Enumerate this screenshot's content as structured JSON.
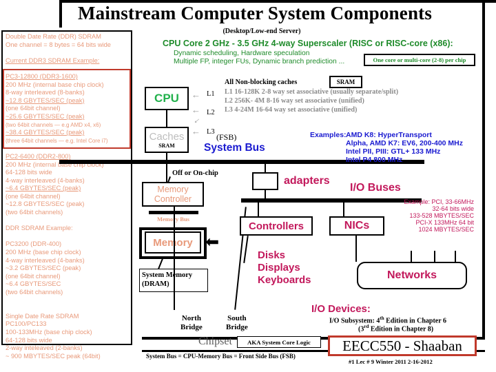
{
  "title": "Mainstream Computer System Components",
  "subtitle": "(Desktop/Low-end Server)",
  "ddr_panel": {
    "header": [
      "Double Date Rate (DDR) SDRAM",
      "One channel = 8 bytes = 64 bits wide"
    ],
    "ddr3_example_title": "Current DDR3 SDRAM Example:",
    "ddr3_lines": [
      "PC3-12800 (DDR3-1600)",
      "200 MHz (internal base chip clock)",
      "8-way interleaved (8-banks)",
      "~12.8 GBYTES/SEC (peak)",
      "(one 64bit channel)",
      "~25.6  GBYTES/SEC (peak)",
      "(two 64bit channels — e.g AMD x4, x6)",
      "~38.4  GBYTES/SEC (peak)",
      "(three 64bit channels — e.g. Intel Core i7)"
    ],
    "ddr2_lines": [
      "PC2-6400 (DDR2-800)",
      "200 MHz (internal base chip clock)",
      "64-128 bits wide",
      "4-way interleaved (4-banks)",
      "~6.4  GBYTES/SEC (peak)",
      "(one 64bit channel)",
      "~12.8  GBYTES/SEC (peak)",
      "(two 64bit channels)"
    ],
    "ddr_example_title": "DDR SDRAM Example:",
    "ddr_lines": [
      "PC3200 (DDR-400)",
      "200 MHz (base chip clock)",
      "4-way interleaved (4-banks)",
      "~3.2  GBYTES/SEC (peak)",
      "(one 64bit channel)",
      "~6.4  GBYTES/SEC",
      "(two 64bit channels)"
    ],
    "sdr_lines": [
      "Single Date Rate SDRAM",
      "PC100/PC133",
      "100-133MHz (base chip clock)",
      "64-128 bits wide",
      "2-way inteleaved (2-banks)",
      "~ 900 MBYTES/SEC peak (64bit)"
    ]
  },
  "cpu_section": {
    "heading": "CPU Core 2 GHz - 3.5 GHz 4-way Superscaler (RISC or RISC-core (x86):",
    "sub1": "Dynamic scheduling, Hardware speculation",
    "sub2": "Multiple FP, integer FUs, Dynamic branch prediction ...",
    "multicore_note": "One core or multi-core (2-8) per chip",
    "cpu_box": "CPU",
    "caches_box": "Caches",
    "caches_sram": "SRAM",
    "sram_box": "SRAM",
    "levels": [
      "L1",
      "L2",
      "L3"
    ]
  },
  "cache_desc": {
    "all": "All   Non-blocking caches",
    "l1": "L1     16-128K        2-8 way set associative (usually separate/split)",
    "l2": "L2     256K- 4M   8-16 way set associative  (unified)",
    "l3": "L3     4-24M          16-64  way set associative  (unified)"
  },
  "system_bus": {
    "fsb": "(FSB)",
    "label": "System Bus",
    "examples_head": "Examples:",
    "examples": [
      "AMD K8: HyperTransport",
      "Alpha, AMD K7:  EV6,  200-400 MHz",
      "Intel  PII, PIII:  GTL+      133 MHz",
      "Intel P4                          800 MHz"
    ]
  },
  "memory_section": {
    "off_or_on_chip": "Off or On-chip",
    "controller_l1": "Memory",
    "controller_l2": "Controller",
    "memory_bus": "Memory Bus",
    "memory": "Memory",
    "system_memory_l1": "System Memory",
    "system_memory_l2": "(DRAM)"
  },
  "chipset": {
    "north_l1": "North",
    "north_l2": "Bridge",
    "south_l1": "South",
    "south_l2": "Bridge",
    "label": "Chipset",
    "aka": "AKA System Core Logic",
    "fsb_note": "System Bus = CPU-Memory Bus = Front Side Bus (FSB)"
  },
  "io_section": {
    "adapters": "adapters",
    "io_buses": "I/O Buses",
    "controllers": "Controllers",
    "nics": "NICs",
    "networks": "Networks",
    "pci_example": [
      "Example:  PCI, 33-66MHz",
      "32-64 bits wide",
      "133-528 MBYTES/SEC",
      "PCI-X 133MHz 64 bit",
      "1024 MBYTES/SEC"
    ],
    "devices": [
      "Disks",
      "Displays",
      "Keyboards"
    ],
    "io_devices_label": "I/O Devices:",
    "io_note_1": "I/O Subsystem: 4",
    "io_note_1_sup": "th",
    "io_note_1_rest": " Edition in Chapter 6",
    "io_note_2": "(3",
    "io_note_2_sup": "rd",
    "io_note_2_rest": " Edition in Chapter 8)"
  },
  "footer": {
    "course": "EECC550 - Shaaban",
    "meta": "#1   Lec # 9  Winter 2011  2-16-2012"
  },
  "colors": {
    "salmon": "#e8997a",
    "green": "#1e8b2a",
    "blue": "#1a1ad0",
    "pink": "#c2185b",
    "red_border": "#c0392b",
    "gray_text": "#8a8a8a"
  }
}
